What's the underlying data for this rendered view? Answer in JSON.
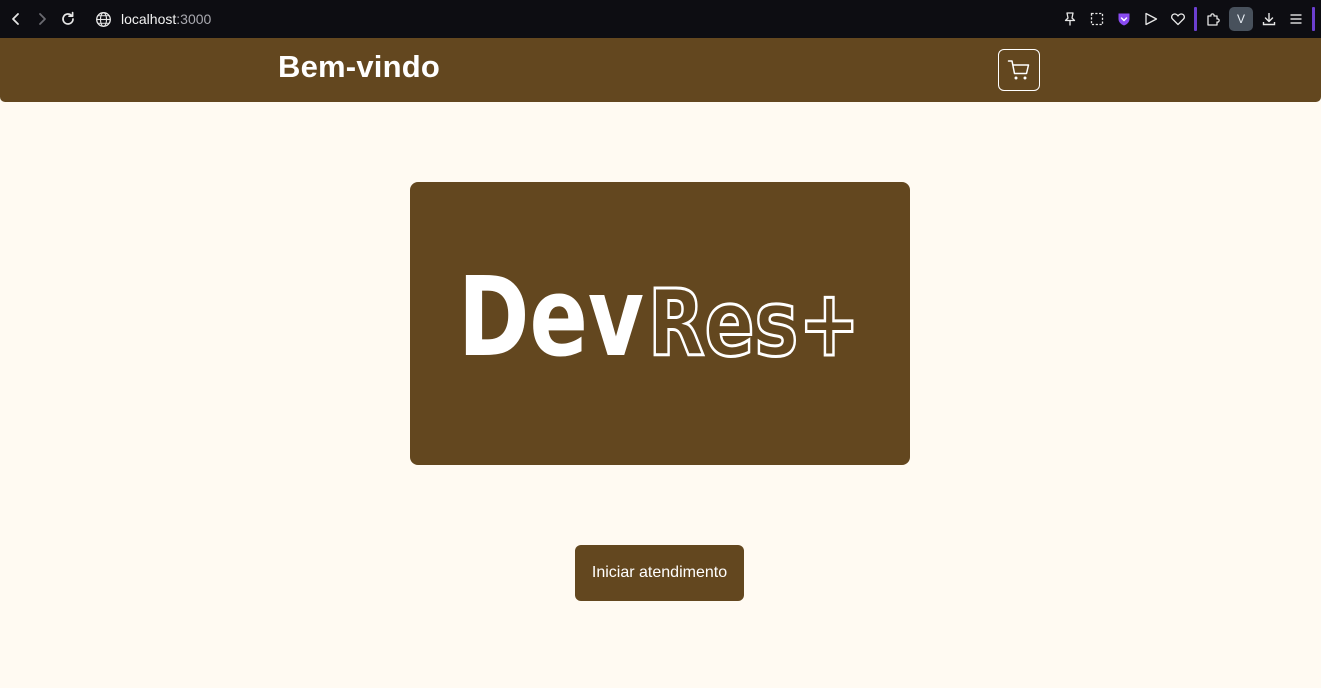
{
  "browser": {
    "url_host": "localhost",
    "url_port": ":3000",
    "profile_initial": "V",
    "accent_color": "#6c3fd1"
  },
  "header": {
    "title": "Bem-vindo",
    "cart_icon": "cart-icon",
    "background_color": "#63471f"
  },
  "logo": {
    "part_solid": "Dev",
    "part_outline": "Res+"
  },
  "actions": {
    "start_label": "Iniciar atendimento"
  },
  "colors": {
    "brand_brown": "#63471f",
    "page_background": "#fffaf2"
  }
}
